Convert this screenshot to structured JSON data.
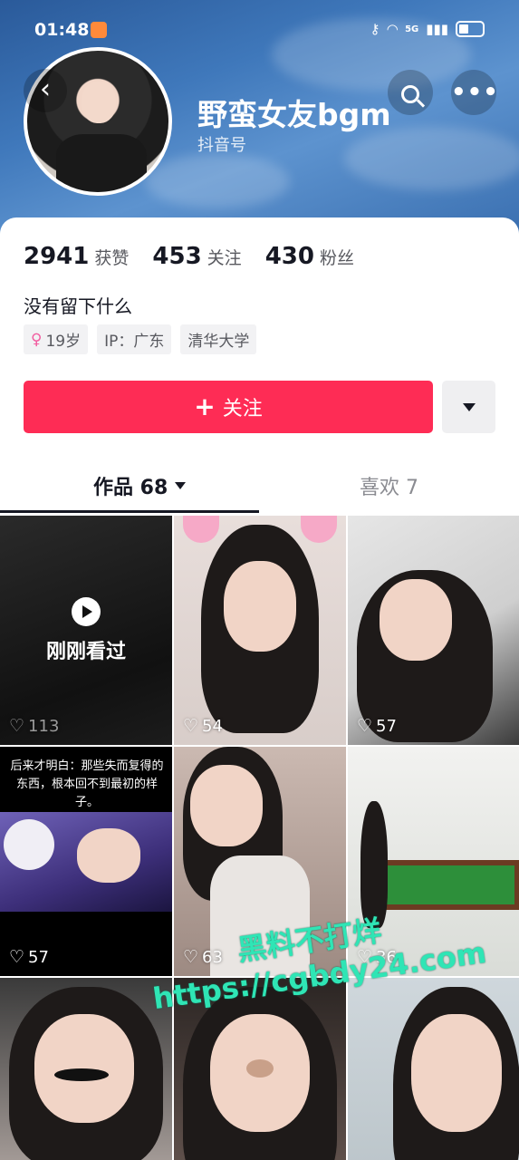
{
  "status_bar": {
    "time": "01:48",
    "network": "5G"
  },
  "header": {
    "name": "野蛮女友bgm",
    "sub_label": "抖音号"
  },
  "stats": [
    {
      "value": "2941",
      "label": "获赞"
    },
    {
      "value": "453",
      "label": "关注"
    },
    {
      "value": "430",
      "label": "粉丝"
    }
  ],
  "bio": "没有留下什么",
  "tags": [
    {
      "icon": "female-icon",
      "label": "19岁"
    },
    {
      "label": "IP：广东"
    },
    {
      "label": "清华大学"
    }
  ],
  "follow_button": {
    "label": "关注",
    "color": "#fe2c55"
  },
  "tabs": [
    {
      "label": "作品 68",
      "active": true
    },
    {
      "label": "喜欢 7",
      "active": false
    }
  ],
  "videos": [
    {
      "likes": "113",
      "overlay": "刚刚看过"
    },
    {
      "likes": "54"
    },
    {
      "likes": "57"
    },
    {
      "likes": "57",
      "caption": "后来才明白：那些失而复得的东西，根本回不到最初的样子。"
    },
    {
      "likes": "63"
    },
    {
      "likes": "36"
    },
    {
      "likes": ""
    },
    {
      "likes": ""
    },
    {
      "likes": ""
    }
  ],
  "watermark": {
    "line1": "黑料不打烊",
    "line2": "https://cgbdy24.com",
    "color": "#2fe5b5"
  }
}
